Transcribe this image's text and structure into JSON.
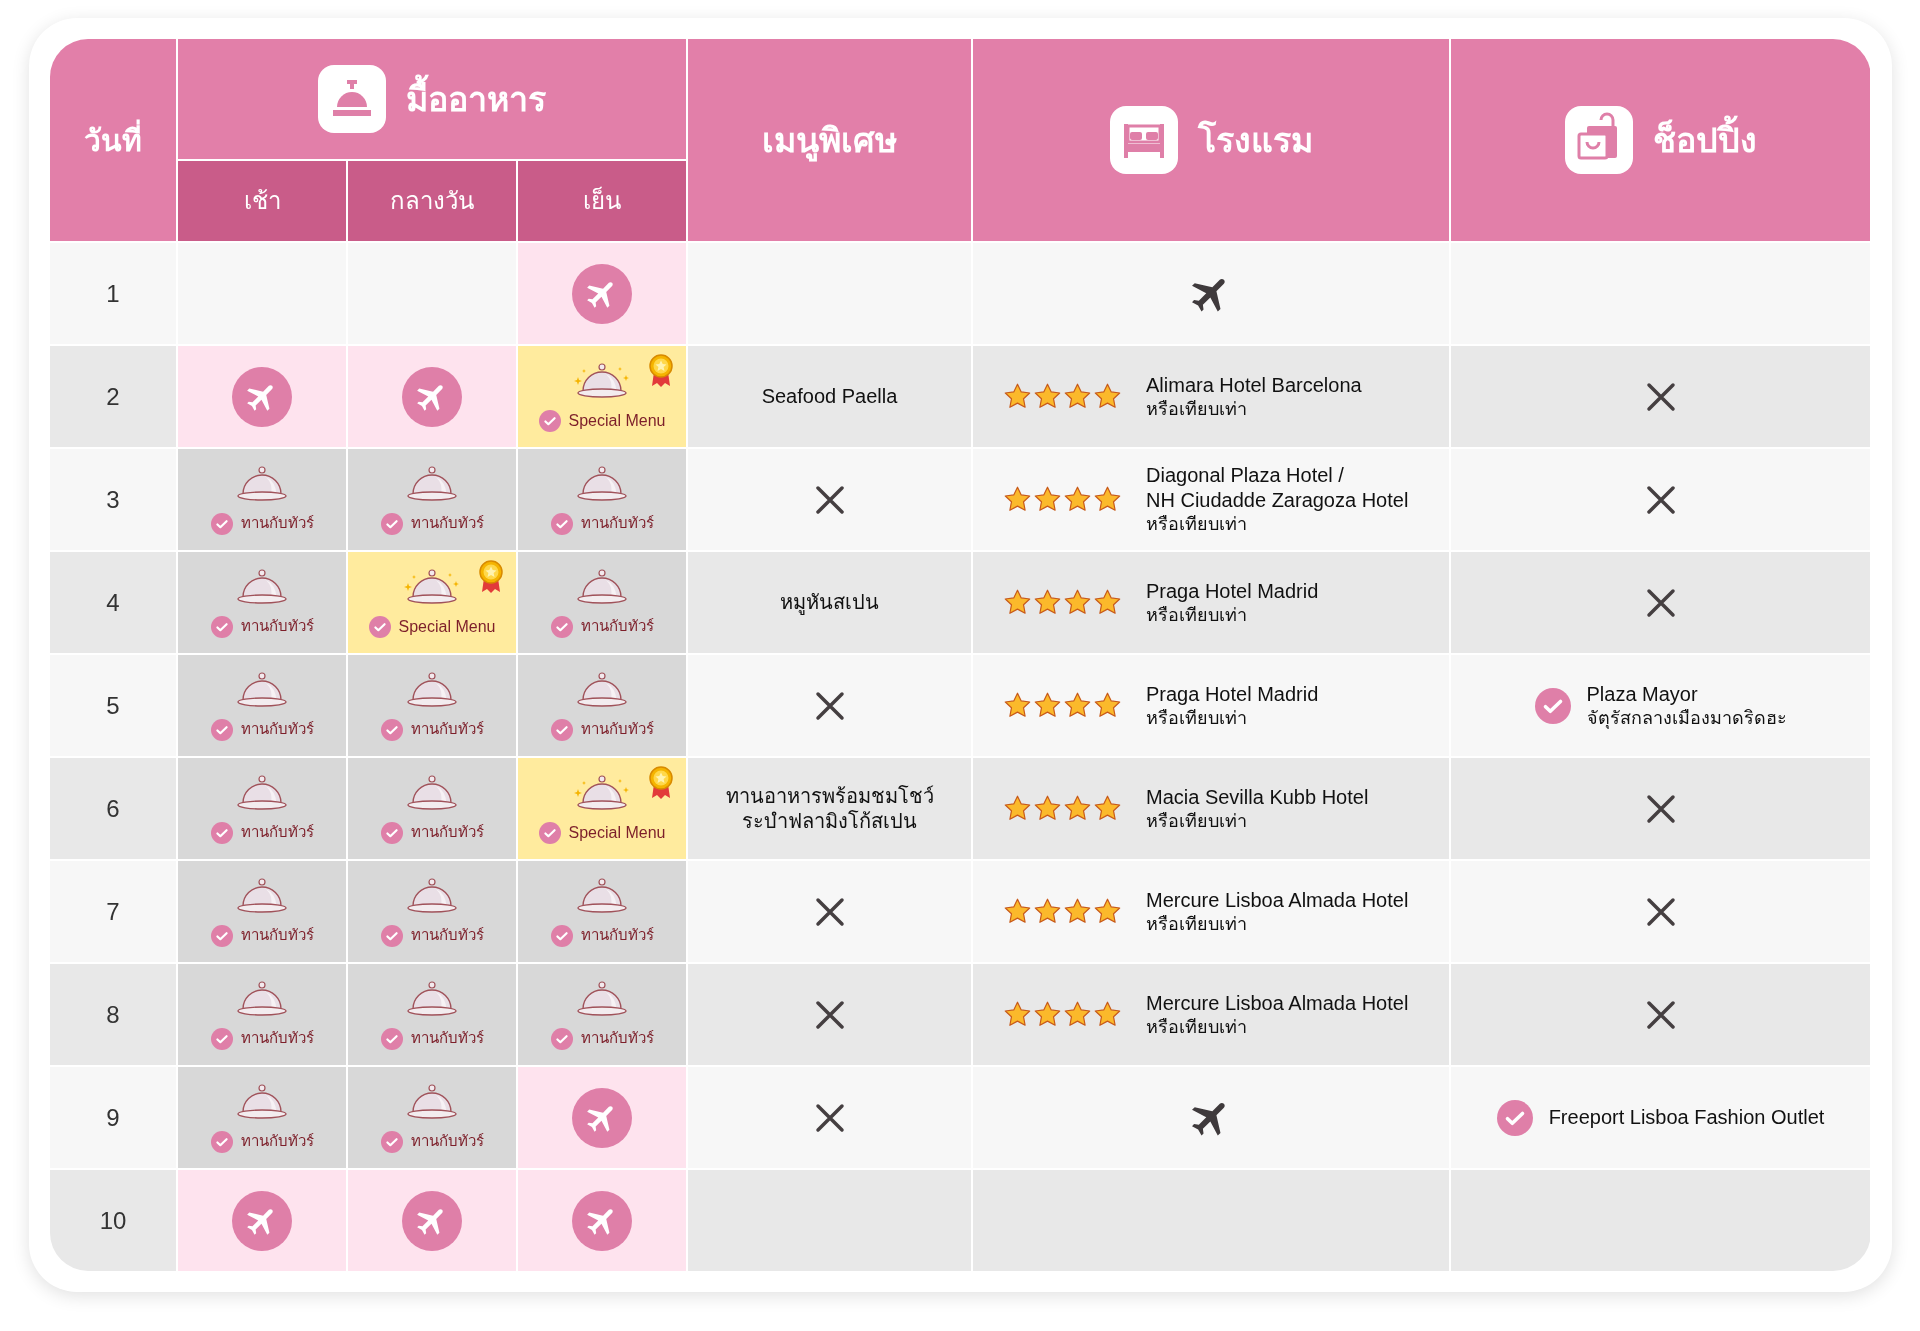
{
  "header": {
    "day": "วันที่",
    "meals": {
      "title": "มื้ออาหาร",
      "columns": [
        "เช้า",
        "กลางวัน",
        "เย็น"
      ]
    },
    "special_menu": "เมนูพิเศษ",
    "hotel": "โรงแรม",
    "shopping": "ช็อปปิ้ง"
  },
  "rows": [
    {
      "day": "1",
      "meals": [
        {
          "kind": "empty"
        },
        {
          "kind": "empty"
        },
        {
          "kind": "flight"
        }
      ],
      "special_menu": {
        "kind": "empty"
      },
      "hotel": {
        "kind": "flight"
      },
      "shopping": {
        "kind": "empty"
      }
    },
    {
      "day": "2",
      "meals": [
        {
          "kind": "flight"
        },
        {
          "kind": "flight"
        },
        {
          "kind": "special",
          "label": "Special Menu"
        }
      ],
      "special_menu": {
        "kind": "text",
        "text": "Seafood Paella"
      },
      "hotel": {
        "kind": "hotel",
        "stars": 4,
        "name": "Alimara Hotel Barcelona",
        "note": "หรือเทียบเท่า"
      },
      "shopping": {
        "kind": "none"
      }
    },
    {
      "day": "3",
      "meals": [
        {
          "kind": "tour",
          "label": "ทานกับทัวร์"
        },
        {
          "kind": "tour",
          "label": "ทานกับทัวร์"
        },
        {
          "kind": "tour",
          "label": "ทานกับทัวร์"
        }
      ],
      "special_menu": {
        "kind": "none"
      },
      "hotel": {
        "kind": "hotel",
        "stars": 4,
        "name": "Diagonal Plaza Hotel /\nNH Ciudadde Zaragoza Hotel",
        "note": "หรือเทียบเท่า"
      },
      "shopping": {
        "kind": "none"
      }
    },
    {
      "day": "4",
      "meals": [
        {
          "kind": "tour",
          "label": "ทานกับทัวร์"
        },
        {
          "kind": "special",
          "label": "Special Menu"
        },
        {
          "kind": "tour",
          "label": "ทานกับทัวร์"
        }
      ],
      "special_menu": {
        "kind": "text",
        "text": "หมูหันสเปน"
      },
      "hotel": {
        "kind": "hotel",
        "stars": 4,
        "name": "Praga Hotel Madrid",
        "note": "หรือเทียบเท่า"
      },
      "shopping": {
        "kind": "none"
      }
    },
    {
      "day": "5",
      "meals": [
        {
          "kind": "tour",
          "label": "ทานกับทัวร์"
        },
        {
          "kind": "tour",
          "label": "ทานกับทัวร์"
        },
        {
          "kind": "tour",
          "label": "ทานกับทัวร์"
        }
      ],
      "special_menu": {
        "kind": "none"
      },
      "hotel": {
        "kind": "hotel",
        "stars": 4,
        "name": "Praga Hotel Madrid",
        "note": "หรือเทียบเท่า"
      },
      "shopping": {
        "kind": "place",
        "name": "Plaza Mayor",
        "note": "จัตุรัสกลางเมืองมาดริดฮะ"
      }
    },
    {
      "day": "6",
      "meals": [
        {
          "kind": "tour",
          "label": "ทานกับทัวร์"
        },
        {
          "kind": "tour",
          "label": "ทานกับทัวร์"
        },
        {
          "kind": "special",
          "label": "Special Menu"
        }
      ],
      "special_menu": {
        "kind": "text",
        "text": "ทานอาหารพร้อมชมโชว์\nระบำฟลามิงโก้สเปน"
      },
      "hotel": {
        "kind": "hotel",
        "stars": 4,
        "name": "Macia Sevilla Kubb Hotel",
        "note": "หรือเทียบเท่า"
      },
      "shopping": {
        "kind": "none"
      }
    },
    {
      "day": "7",
      "meals": [
        {
          "kind": "tour",
          "label": "ทานกับทัวร์"
        },
        {
          "kind": "tour",
          "label": "ทานกับทัวร์"
        },
        {
          "kind": "tour",
          "label": "ทานกับทัวร์"
        }
      ],
      "special_menu": {
        "kind": "none"
      },
      "hotel": {
        "kind": "hotel",
        "stars": 4,
        "name": "Mercure Lisboa Almada Hotel",
        "note": "หรือเทียบเท่า"
      },
      "shopping": {
        "kind": "none"
      }
    },
    {
      "day": "8",
      "meals": [
        {
          "kind": "tour",
          "label": "ทานกับทัวร์"
        },
        {
          "kind": "tour",
          "label": "ทานกับทัวร์"
        },
        {
          "kind": "tour",
          "label": "ทานกับทัวร์"
        }
      ],
      "special_menu": {
        "kind": "none"
      },
      "hotel": {
        "kind": "hotel",
        "stars": 4,
        "name": "Mercure Lisboa Almada Hotel",
        "note": "หรือเทียบเท่า"
      },
      "shopping": {
        "kind": "none"
      }
    },
    {
      "day": "9",
      "meals": [
        {
          "kind": "tour",
          "label": "ทานกับทัวร์"
        },
        {
          "kind": "tour",
          "label": "ทานกับทัวร์"
        },
        {
          "kind": "flight"
        }
      ],
      "special_menu": {
        "kind": "none"
      },
      "hotel": {
        "kind": "flight"
      },
      "shopping": {
        "kind": "place",
        "name": "Freeport Lisboa Fashion Outlet"
      }
    },
    {
      "day": "10",
      "meals": [
        {
          "kind": "flight"
        },
        {
          "kind": "flight"
        },
        {
          "kind": "flight"
        }
      ],
      "special_menu": {
        "kind": "empty"
      },
      "hotel": {
        "kind": "empty"
      },
      "shopping": {
        "kind": "empty"
      }
    }
  ]
}
